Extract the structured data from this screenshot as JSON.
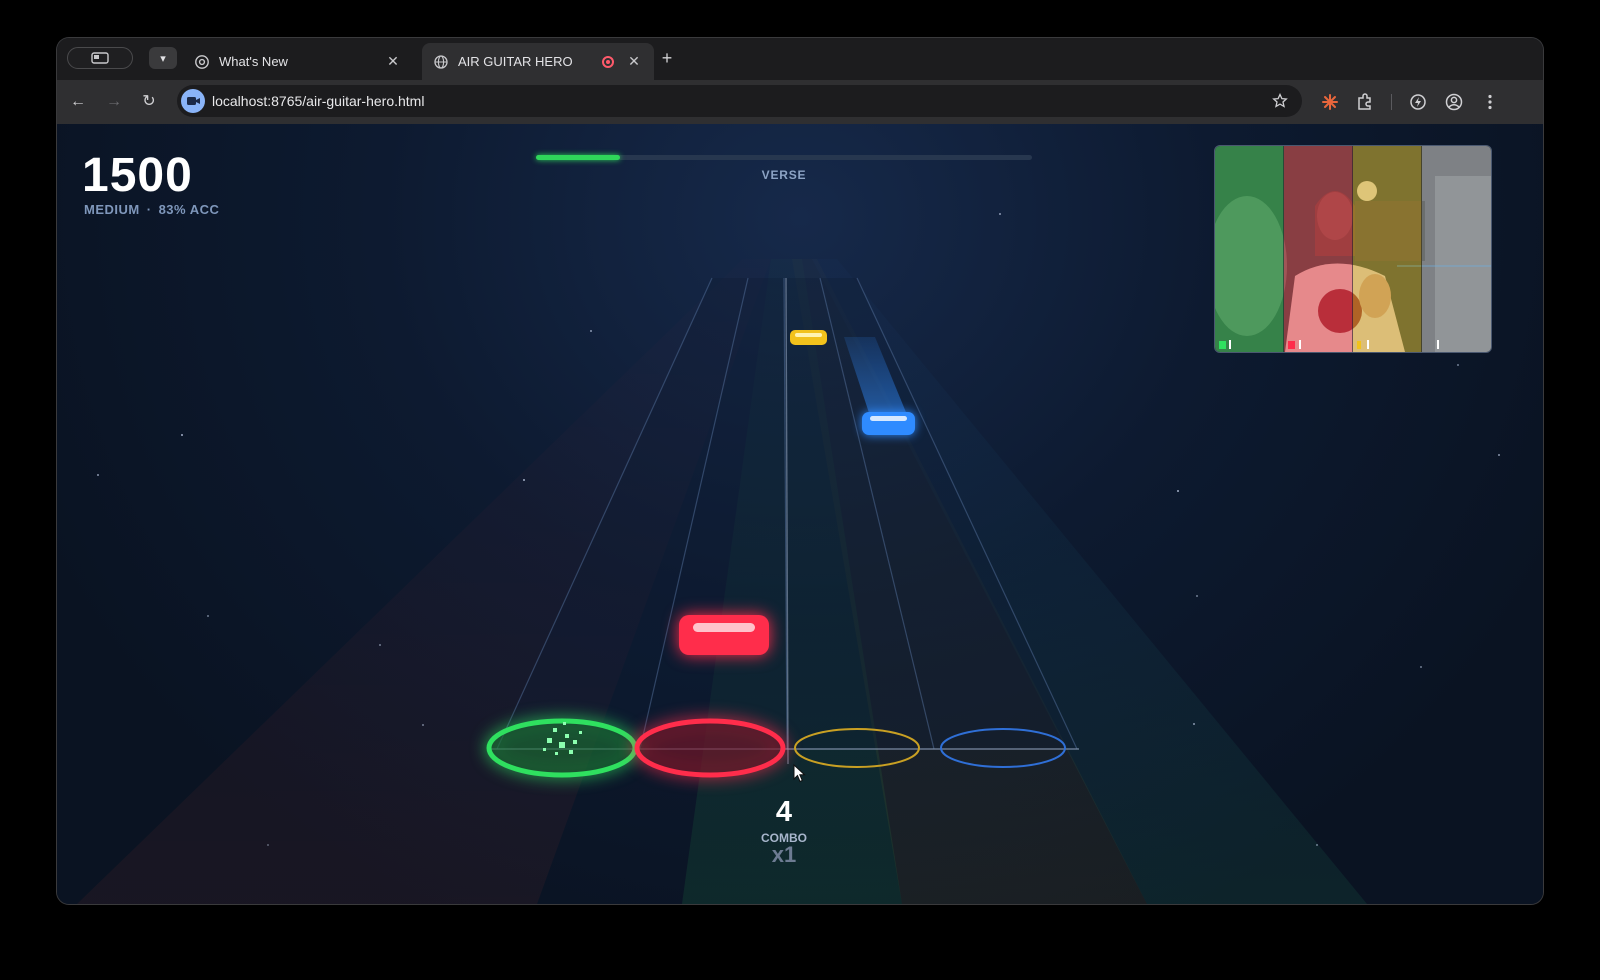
{
  "browser": {
    "tabs": [
      {
        "title": "What's New",
        "active": false
      },
      {
        "title": "AIR GUITAR HERO",
        "active": true,
        "recording": true
      }
    ],
    "url": "localhost:8765/air-guitar-hero.html"
  },
  "hud": {
    "score": "1500",
    "difficulty": "MEDIUM",
    "separator": "·",
    "accuracy": "83% ACC",
    "song_progress": 0.17,
    "section": "VERSE"
  },
  "combo": {
    "count": "4",
    "label": "COMBO",
    "multiplier": "x1"
  },
  "lanes": [
    {
      "name": "green",
      "color": "#2fe05f"
    },
    {
      "name": "red",
      "color": "#ff2d4b"
    },
    {
      "name": "yellow",
      "color": "#e6b21a"
    },
    {
      "name": "blue",
      "color": "#2f8bff"
    }
  ],
  "camera_zones": [
    {
      "lane": "green",
      "color": "#2fd65a"
    },
    {
      "lane": "red",
      "color": "#ff2d4b"
    },
    {
      "lane": "yellow",
      "color": "#e6b21a"
    },
    {
      "lane": "blue",
      "color": "#9aa4b4"
    }
  ]
}
